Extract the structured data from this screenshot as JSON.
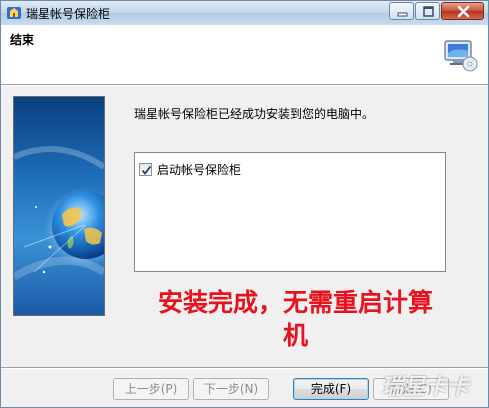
{
  "window": {
    "title": "瑞星帐号保险柜",
    "controls": {
      "minimize_icon": "minimize-icon",
      "maximize_icon": "maximize-icon",
      "close_icon": "close-icon"
    }
  },
  "header": {
    "title": "结束",
    "icon": "monitor-disc-icon"
  },
  "banner": {
    "image": "globe-banner"
  },
  "content": {
    "message": "瑞星帐号保险柜已经成功安装到您的电脑中。",
    "launch_checkbox": {
      "label": "启动帐号保险柜",
      "checked": true
    }
  },
  "annotation": {
    "line1": "安装完成，无需重启计算",
    "line2": "机"
  },
  "buttons": {
    "back": {
      "label": "上一步(P)",
      "enabled": false
    },
    "next": {
      "label": "下一步(N)",
      "enabled": false
    },
    "finish": {
      "label": "完成(F)",
      "enabled": true
    },
    "cancel": {
      "label": "取消(C)",
      "enabled": false
    }
  },
  "watermark": {
    "text": "瑞星卡卡"
  },
  "colors": {
    "annotation": "#e8121e",
    "titlebar": "#c2d6ea",
    "close_button": "#c8503a"
  }
}
